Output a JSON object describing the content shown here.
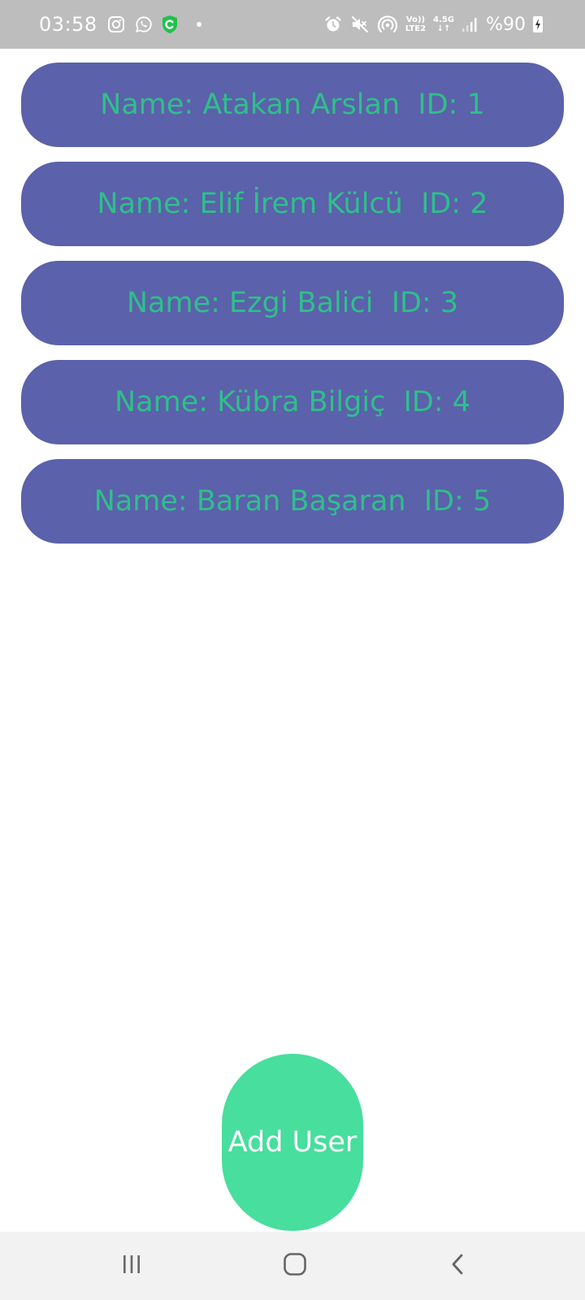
{
  "status_bar": {
    "time": "03:58",
    "network_top": "Vo))",
    "network_bottom": "LTE2",
    "data_top": "4.5G",
    "data_bottom": "↓↑",
    "battery": "%90",
    "icons": [
      "instagram-icon",
      "whatsapp-icon",
      "c-app-icon",
      "notification-dot",
      "alarm-icon",
      "mute-icon",
      "hotspot-icon",
      "volte-indicator",
      "mobile-data-icon",
      "signal-icon",
      "battery-charging-icon"
    ]
  },
  "users": [
    {
      "label": "Name: Atakan Arslan  ID: 1"
    },
    {
      "label": "Name: Elif İrem Külcü  ID: 2"
    },
    {
      "label": "Name: Ezgi Balici  ID: 3"
    },
    {
      "label": "Name: Kübra Bilgiç  ID: 4"
    },
    {
      "label": "Name: Baran Başaran  ID: 5"
    }
  ],
  "add_user_label": "Add User",
  "colors": {
    "card_bg": "#5b61aa",
    "card_text": "#2fbf8c",
    "button_bg": "#47de9e",
    "status_bar_bg": "#bdbdbd"
  },
  "nav": {
    "icons": [
      "recent-apps-icon",
      "home-icon",
      "back-icon"
    ]
  }
}
